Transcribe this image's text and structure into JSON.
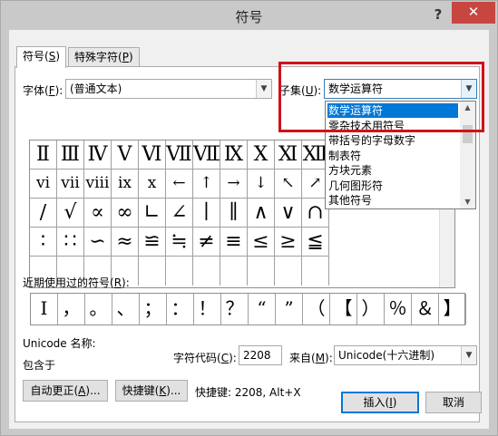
{
  "window": {
    "title": "符号",
    "help": "?",
    "close": "✕"
  },
  "tabs": [
    {
      "label": "符号(",
      "key": "S",
      "end": ")"
    },
    {
      "label": "特殊字符(",
      "key": "P",
      "end": ")"
    }
  ],
  "font": {
    "label": "字体(",
    "key": "F",
    "end": "):",
    "value": "(普通文本)"
  },
  "subset": {
    "label": "子集(",
    "key": "U",
    "end": "):",
    "value": "数学运算符"
  },
  "subset_options": [
    "数学运算符",
    "零杂技术用符号",
    "带括号的字母数字",
    "制表符",
    "方块元素",
    "几何图形符",
    "其他符号"
  ],
  "grid_rows": [
    [
      "Ⅱ",
      "Ⅲ",
      "Ⅳ",
      "Ⅴ",
      "Ⅵ",
      "Ⅶ",
      "Ⅷ",
      "Ⅸ",
      "Ⅹ",
      "Ⅺ",
      "Ⅻ"
    ],
    [
      "ⅵ",
      "ⅶ",
      "ⅷ",
      "ⅸ",
      "x",
      "←",
      "↑",
      "→",
      "↓",
      "↖",
      "↗"
    ],
    [
      "∕",
      "√",
      "∝",
      "∞",
      "∟",
      "∠",
      "∣",
      "∥",
      "∧",
      "∨",
      "∩"
    ],
    [
      "∶",
      "∷",
      "∽",
      "≈",
      "≌",
      "≒",
      "≠",
      "≡",
      "≤",
      "≥",
      "≦"
    ]
  ],
  "recent": {
    "label": "近期使用过的符号(",
    "key": "R",
    "end": "):",
    "symbols": [
      "I",
      "，",
      "。",
      "、",
      "；",
      "：",
      "！",
      "？",
      "“",
      "”",
      "（",
      "【",
      "）",
      "％",
      "＆",
      "】"
    ]
  },
  "unicode": {
    "name_label": "Unicode 名称:",
    "contained_label": "包含于"
  },
  "char_code": {
    "label": "字符代码(",
    "key": "C",
    "end": "):",
    "value": "2208"
  },
  "from": {
    "label": "来自(",
    "key": "M",
    "end": "):",
    "value": "Unicode(十六进制)"
  },
  "buttons": {
    "autocorrect": {
      "label": "自动更正(",
      "key": "A",
      "end": ")..."
    },
    "shortcut": {
      "label": "快捷键(",
      "key": "K",
      "end": ")..."
    },
    "shortcut_text": "快捷键: 2208, Alt+X",
    "insert": {
      "label": "插入(",
      "key": "I",
      "end": ")"
    },
    "cancel": "取消"
  }
}
